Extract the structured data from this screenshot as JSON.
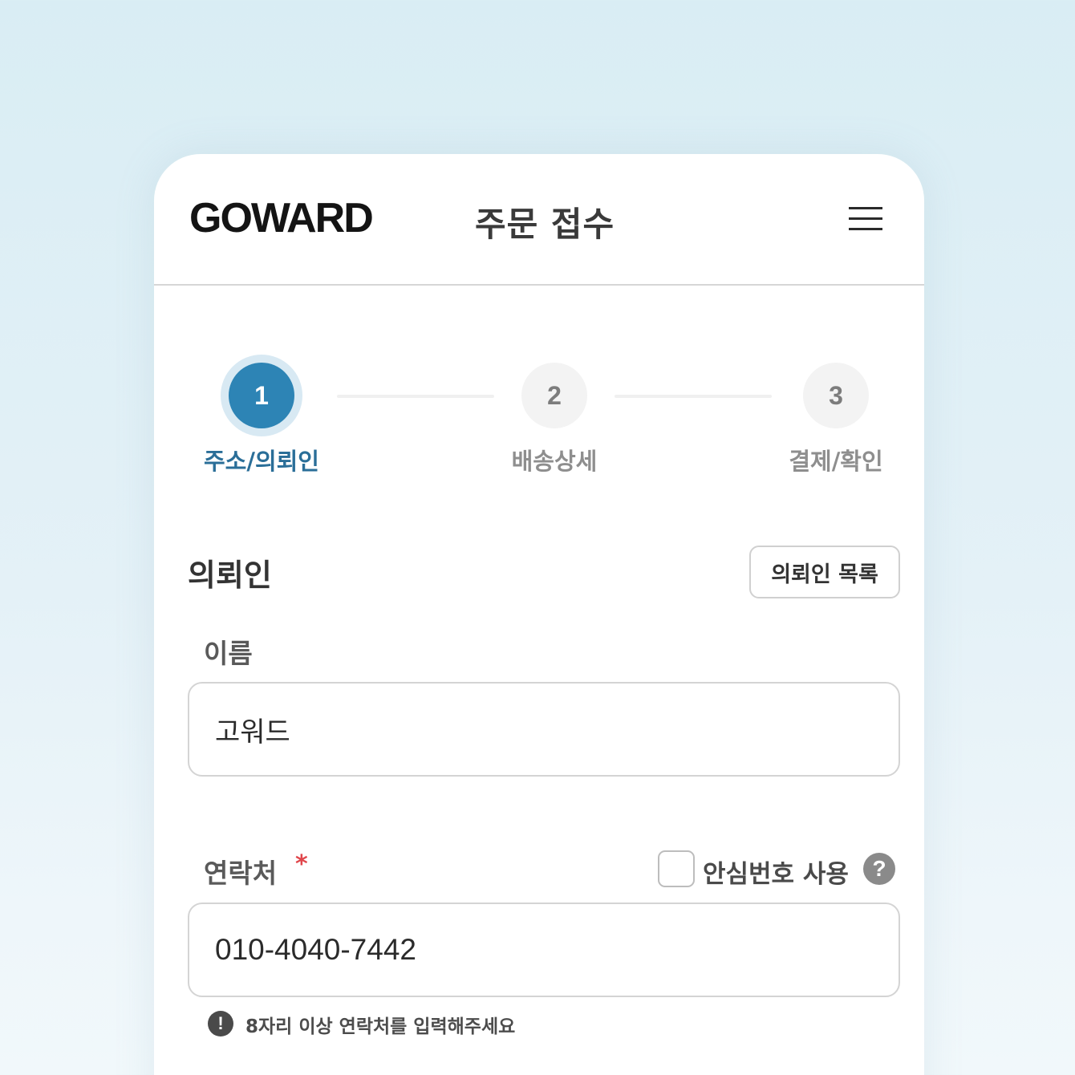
{
  "header": {
    "logo": "GOWARD",
    "title": "주문 접수",
    "menu_icon": "hamburger-menu-icon"
  },
  "stepper": {
    "current_step": 1,
    "steps": [
      {
        "number": "1",
        "label": "주소/의뢰인"
      },
      {
        "number": "2",
        "label": "배송상세"
      },
      {
        "number": "3",
        "label": "결제/확인"
      }
    ]
  },
  "section": {
    "title": "의뢰인",
    "list_button": "의뢰인 목록"
  },
  "name_field": {
    "label": "이름",
    "value": "고워드"
  },
  "phone_field": {
    "label": "연락처",
    "required_mark": "*",
    "value": "010-4040-7442",
    "safe_number_label": "안심번호 사용",
    "safe_number_checked": false,
    "help_icon": "?",
    "error_icon": "!",
    "error_message": "8자리 이상 연락처를 입력해주세요"
  },
  "colors": {
    "accent": "#2d84b5",
    "accent_text": "#2a6e98",
    "required": "#e0464b"
  }
}
